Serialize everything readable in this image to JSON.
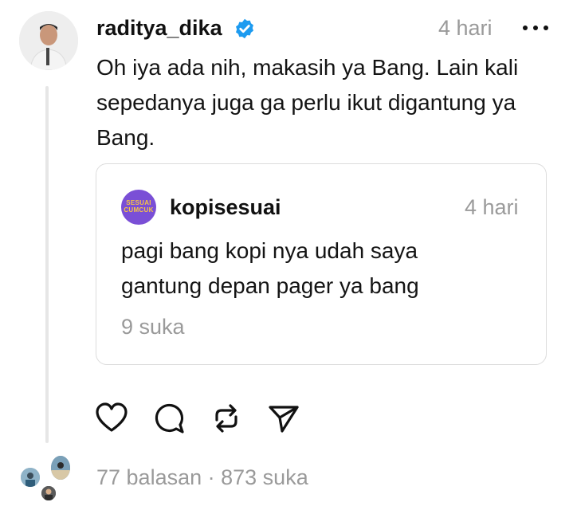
{
  "post": {
    "username": "raditya_dika",
    "time": "4 hari",
    "text": "Oh iya ada nih, makasih ya Bang. Lain kali sepedanya juga ga perlu ikut digantung ya Bang."
  },
  "quote": {
    "username": "kopisesuai",
    "avatar_text": "SESUAI CUMCUK",
    "time": "4 hari",
    "text": "pagi bang kopi nya udah saya gantung depan pager ya bang",
    "likes": "9 suka"
  },
  "stats": {
    "replies": "77 balasan",
    "separator": " · ",
    "likes": "873 suka"
  },
  "icons": {
    "verified": "verified-badge-icon",
    "more": "more-dots-icon",
    "like": "heart-icon",
    "comment": "comment-bubble-icon",
    "repost": "repost-icon",
    "share": "send-icon"
  },
  "colors": {
    "verified": "#1d9bf0",
    "muted": "#9a9a9a",
    "quote_avatar": "#7a4fd6"
  }
}
